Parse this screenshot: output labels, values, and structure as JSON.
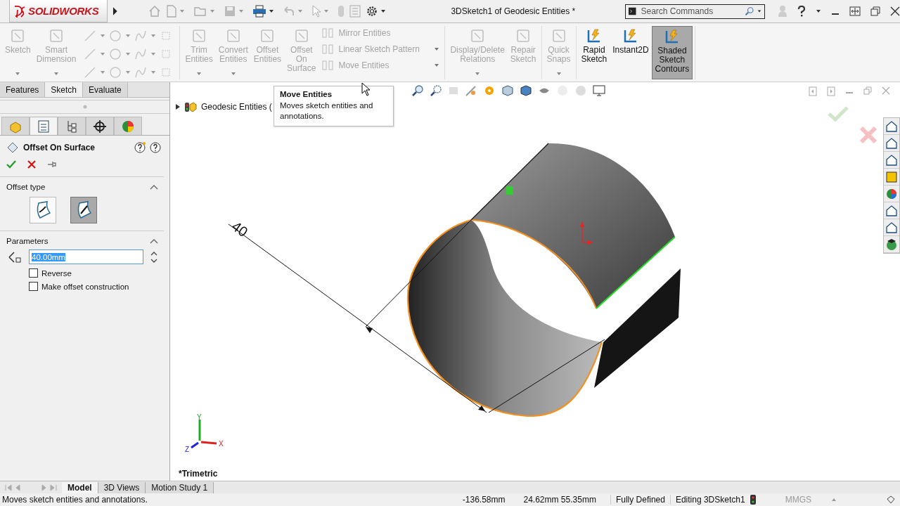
{
  "app": {
    "logo": "SOLIDWORKS"
  },
  "window": {
    "title": "3DSketch1 of Geodesic Entities *"
  },
  "search": {
    "placeholder": "Search Commands"
  },
  "command_manager": {
    "groups": [
      {
        "items": [
          {
            "kind": "large",
            "label": "Sketch",
            "disabled": true,
            "dropdown": true,
            "selected": false
          },
          {
            "kind": "large",
            "label": "Smart Dimension",
            "disabled": true,
            "dropdown": true,
            "selected": false
          },
          {
            "kind": "tools",
            "disabled": true
          }
        ]
      },
      {
        "items": [
          {
            "kind": "large",
            "label": "Trim Entities",
            "disabled": true,
            "dropdown": true,
            "selected": false
          },
          {
            "kind": "large",
            "label": "Convert Entities",
            "disabled": true,
            "dropdown": true,
            "selected": false
          },
          {
            "kind": "large",
            "label": "Offset Entities",
            "disabled": true,
            "dropdown": false,
            "selected": false
          },
          {
            "kind": "large",
            "label": "Offset On Surface",
            "disabled": true,
            "dropdown": false,
            "selected": false
          },
          {
            "kind": "stack",
            "items": [
              {
                "label": "Mirror Entities",
                "disabled": true,
                "dropdown": false
              },
              {
                "label": "Linear Sketch Pattern",
                "disabled": true,
                "dropdown": true
              },
              {
                "label": "Move Entities",
                "disabled": true,
                "dropdown": true
              }
            ]
          }
        ]
      },
      {
        "items": [
          {
            "kind": "large",
            "label": "Display/Delete Relations",
            "disabled": true,
            "dropdown": true,
            "selected": false
          },
          {
            "kind": "large",
            "label": "Repair Sketch",
            "disabled": true,
            "dropdown": false,
            "selected": false
          }
        ]
      },
      {
        "items": [
          {
            "kind": "large",
            "label": "Quick Snaps",
            "disabled": true,
            "dropdown": true,
            "selected": false
          }
        ]
      },
      {
        "items": [
          {
            "kind": "large",
            "label": "Rapid Sketch",
            "disabled": false,
            "dropdown": false,
            "selected": false
          },
          {
            "kind": "large",
            "label": "Instant2D",
            "disabled": false,
            "dropdown": false,
            "selected": false
          },
          {
            "kind": "large",
            "label": "Shaded Sketch Contours",
            "disabled": false,
            "dropdown": false,
            "selected": true
          }
        ]
      }
    ]
  },
  "command_tabs": [
    {
      "label": "Features",
      "selected": false
    },
    {
      "label": "Sketch",
      "selected": true
    },
    {
      "label": "Evaluate",
      "selected": false
    }
  ],
  "panel_tabs": [
    {
      "selected": false
    },
    {
      "selected": true
    },
    {
      "selected": false
    },
    {
      "selected": false
    },
    {
      "selected": false
    }
  ],
  "property_manager": {
    "title": "Offset On Surface",
    "offset_type": {
      "title": "Offset type",
      "options": [
        {
          "selected": false
        },
        {
          "selected": true
        }
      ]
    },
    "parameters": {
      "title": "Parameters",
      "value": "40.00mm",
      "checkboxes": [
        {
          "label": "Reverse",
          "checked": false
        },
        {
          "label": "Make offset construction",
          "checked": false
        }
      ]
    }
  },
  "viewport": {
    "tree_item": "Geodesic Entities (",
    "tooltip": {
      "title": "Move Entities",
      "text": "Moves sketch entities and annotations."
    },
    "dimension": "40",
    "view_label": "*Trimetric",
    "axes": {
      "x": "X",
      "y": "Y",
      "z": "Z"
    }
  },
  "bottom_tabs": [
    {
      "label": "Model",
      "selected": true
    },
    {
      "label": "3D Views",
      "selected": false
    },
    {
      "label": "Motion Study 1",
      "selected": false
    }
  ],
  "status_bar": {
    "message": "Moves sketch entities and annotations.",
    "x": "-136.58mm",
    "yz": "24.62mm 55.35mm",
    "state": "Fully Defined",
    "mode": "Editing 3DSketch1",
    "units": "MMGS"
  }
}
